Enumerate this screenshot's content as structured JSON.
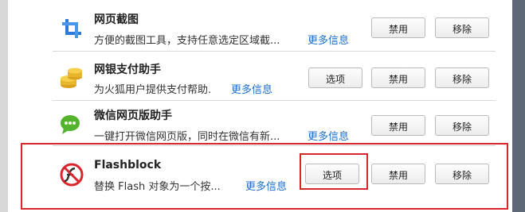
{
  "addons": [
    {
      "name": "网页截图",
      "description": "方便的截图工具，支持任意选定区域截...",
      "more_info": "更多信息",
      "options": null,
      "disable": "禁用",
      "remove": "移除",
      "icon": "crop-icon"
    },
    {
      "name": "网银支付助手",
      "description": "为火狐用户提供支付帮助.",
      "more_info": "更多信息",
      "options": "选项",
      "disable": "禁用",
      "remove": "移除",
      "icon": "gold-coins-icon"
    },
    {
      "name": "微信网页版助手",
      "description": "一键打开微信网页版，同时在微信有新...",
      "more_info": "更多信息",
      "options": null,
      "disable": "禁用",
      "remove": "移除",
      "icon": "wechat-icon"
    },
    {
      "name": "Flashblock",
      "description": "替换 Flash 对象为一个按...",
      "more_info": "更多信息",
      "options": "选项",
      "disable": "禁用",
      "remove": "移除",
      "icon": "flashblock-icon"
    }
  ],
  "colors": {
    "link": "#1a6fd1",
    "highlight": "#d8262c",
    "scroll_strip": "#5d6977"
  }
}
